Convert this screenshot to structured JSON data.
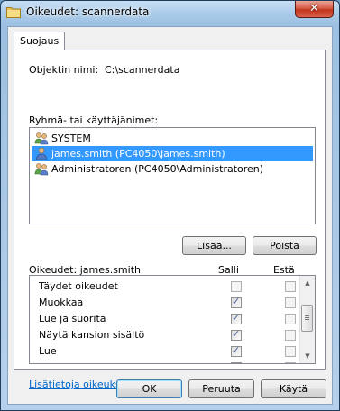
{
  "window": {
    "title": "Oikeudet: scannerdata",
    "close_glyph": "✕"
  },
  "tabs": [
    {
      "label": "Suojaus"
    }
  ],
  "object": {
    "label": "Objektin nimi:",
    "value": "C:\\scannerdata"
  },
  "groups": {
    "label": "Ryhmä- tai käyttäjänimet:",
    "items": [
      {
        "name": "SYSTEM",
        "icon": "users-group-icon",
        "selected": false
      },
      {
        "name": "james.smith (PC4050\\james.smith)",
        "icon": "user-icon",
        "selected": true
      },
      {
        "name": "Administratoren (PC4050\\Administratoren)",
        "icon": "users-group-icon",
        "selected": false
      }
    ],
    "add_label": "Lisää...",
    "remove_label": "Poista"
  },
  "permissions": {
    "label": "Oikeudet: james.smith",
    "allow_header": "Salli",
    "deny_header": "Estä",
    "rows": [
      {
        "name": "Täydet oikeudet",
        "allow": false,
        "deny": false
      },
      {
        "name": "Muokkaa",
        "allow": true,
        "deny": false
      },
      {
        "name": "Lue ja suorita",
        "allow": true,
        "deny": false
      },
      {
        "name": "Näytä kansion sisältö",
        "allow": true,
        "deny": false
      },
      {
        "name": "Lue",
        "allow": true,
        "deny": false
      }
    ]
  },
  "link_text": "Lisätietoja oikeuksista",
  "buttons": {
    "ok": "OK",
    "cancel": "Peruuta",
    "apply": "Käytä"
  },
  "colors": {
    "selection": "#3399ff",
    "link": "#0066cc",
    "close": "#c2351d"
  }
}
